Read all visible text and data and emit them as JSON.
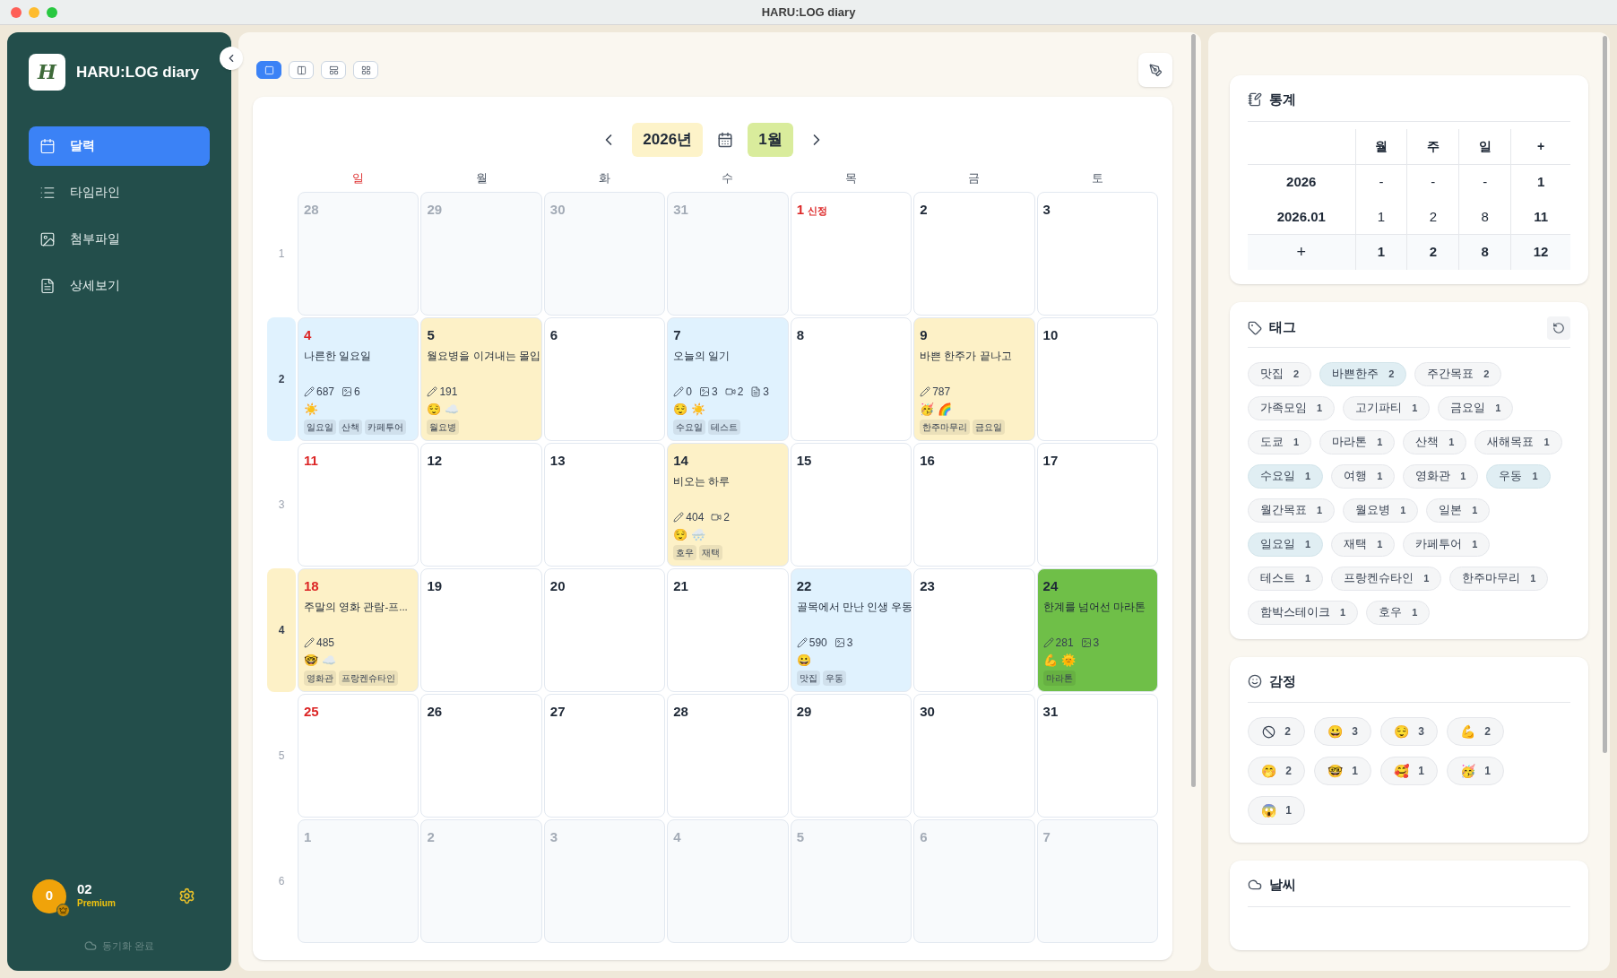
{
  "window": {
    "title": "HARU:LOG diary"
  },
  "sidebar": {
    "logo": "H",
    "app_name": "HARU:LOG diary",
    "items": [
      {
        "label": "달력",
        "selected": true
      },
      {
        "label": "타임라인",
        "selected": false
      },
      {
        "label": "첨부파일",
        "selected": false
      },
      {
        "label": "상세보기",
        "selected": false
      }
    ],
    "user": {
      "avatar": "0",
      "name": "02",
      "plan": "Premium"
    },
    "sync": "동기화 완료"
  },
  "toolbar": {
    "view_buttons": [
      {
        "selected": true
      },
      {
        "selected": false
      },
      {
        "selected": false
      },
      {
        "selected": false
      }
    ]
  },
  "calendar": {
    "year": "2026년",
    "month": "1월",
    "weekdays": [
      "일",
      "월",
      "화",
      "수",
      "목",
      "금",
      "토"
    ],
    "weeks": [
      {
        "number": "1",
        "days": [
          {
            "date": "28",
            "muted": true
          },
          {
            "date": "29",
            "muted": true
          },
          {
            "date": "30",
            "muted": true
          },
          {
            "date": "31",
            "muted": true
          },
          {
            "date": "1",
            "muted": false,
            "holiday": "신정"
          },
          {
            "date": "2",
            "muted": false
          },
          {
            "date": "3",
            "muted": false
          }
        ]
      },
      {
        "number": "2",
        "color": "#e0f2fe",
        "days": [
          {
            "date": "4",
            "muted": false,
            "entry": {
              "color": "#e0f2fe",
              "title": "나른한 일요일",
              "stats": [
                {
                  "kind": "words",
                  "value": "687"
                },
                {
                  "kind": "images",
                  "value": "6"
                }
              ],
              "emojis": [
                "☀️"
              ],
              "tags": [
                "일요일",
                "산책",
                "카페투어"
              ]
            }
          },
          {
            "date": "5",
            "muted": false,
            "entry": {
              "color": "#fdf1c7",
              "title": "월요병을 이겨내는 몰입",
              "stats": [
                {
                  "kind": "words",
                  "value": "191"
                }
              ],
              "emojis": [
                "😌",
                "☁️"
              ],
              "tags": [
                "월요병"
              ]
            }
          },
          {
            "date": "6",
            "muted": false
          },
          {
            "date": "7",
            "muted": false,
            "entry": {
              "color": "#e0f2fe",
              "title": "오늘의 일기",
              "stats": [
                {
                  "kind": "words",
                  "value": "0"
                },
                {
                  "kind": "images",
                  "value": "3"
                },
                {
                  "kind": "videos",
                  "value": "2"
                },
                {
                  "kind": "files",
                  "value": "3"
                }
              ],
              "emojis": [
                "😌",
                "☀️"
              ],
              "tags": [
                "수요일",
                "테스트"
              ]
            }
          },
          {
            "date": "8",
            "muted": false
          },
          {
            "date": "9",
            "muted": false,
            "entry": {
              "color": "#fdf1c7",
              "title": "바쁜 한주가 끝나고",
              "stats": [
                {
                  "kind": "words",
                  "value": "787"
                }
              ],
              "emojis": [
                "🥳",
                "🌈"
              ],
              "tags": [
                "한주마무리",
                "금요일"
              ]
            }
          },
          {
            "date": "10",
            "muted": false
          }
        ]
      },
      {
        "number": "3",
        "days": [
          {
            "date": "11",
            "muted": false
          },
          {
            "date": "12",
            "muted": false
          },
          {
            "date": "13",
            "muted": false
          },
          {
            "date": "14",
            "muted": false,
            "entry": {
              "color": "#fdf1c7",
              "title": "비오는 하루",
              "stats": [
                {
                  "kind": "words",
                  "value": "404"
                },
                {
                  "kind": "videos",
                  "value": "2"
                }
              ],
              "emojis": [
                "😌",
                "🌨️"
              ],
              "tags": [
                "호우",
                "재택"
              ]
            }
          },
          {
            "date": "15",
            "muted": false
          },
          {
            "date": "16",
            "muted": false
          },
          {
            "date": "17",
            "muted": false
          }
        ]
      },
      {
        "number": "4",
        "color": "#fdf1c7",
        "days": [
          {
            "date": "18",
            "muted": false,
            "entry": {
              "color": "#fdf1c7",
              "title": "주말의 영화 관람-프...",
              "stats": [
                {
                  "kind": "words",
                  "value": "485"
                }
              ],
              "emojis": [
                "🤓",
                "☁️"
              ],
              "tags": [
                "영화관",
                "프랑켄슈타인"
              ]
            }
          },
          {
            "date": "19",
            "muted": false
          },
          {
            "date": "20",
            "muted": false
          },
          {
            "date": "21",
            "muted": false
          },
          {
            "date": "22",
            "muted": false,
            "entry": {
              "color": "#e0f2fe",
              "title": "골목에서 만난 인생 우동",
              "stats": [
                {
                  "kind": "words",
                  "value": "590"
                },
                {
                  "kind": "images",
                  "value": "3"
                }
              ],
              "emojis": [
                "😀"
              ],
              "tags": [
                "맛집",
                "우동"
              ]
            }
          },
          {
            "date": "23",
            "muted": false
          },
          {
            "date": "24",
            "muted": false,
            "entry": {
              "color": "#6fbf48",
              "title": "한계를 넘어선 마라톤",
              "stats": [
                {
                  "kind": "words",
                  "value": "281"
                },
                {
                  "kind": "images",
                  "value": "3"
                }
              ],
              "emojis": [
                "💪",
                "🌞"
              ],
              "tags": [
                "마라톤"
              ]
            }
          }
        ]
      },
      {
        "number": "5",
        "days": [
          {
            "date": "25",
            "muted": false
          },
          {
            "date": "26",
            "muted": false
          },
          {
            "date": "27",
            "muted": false
          },
          {
            "date": "28",
            "muted": false
          },
          {
            "date": "29",
            "muted": false
          },
          {
            "date": "30",
            "muted": false
          },
          {
            "date": "31",
            "muted": false
          }
        ]
      },
      {
        "number": "6",
        "days": [
          {
            "date": "1",
            "muted": true
          },
          {
            "date": "2",
            "muted": true
          },
          {
            "date": "3",
            "muted": true
          },
          {
            "date": "4",
            "muted": true
          },
          {
            "date": "5",
            "muted": true
          },
          {
            "date": "6",
            "muted": true
          },
          {
            "date": "7",
            "muted": true
          }
        ]
      }
    ]
  },
  "stats": {
    "title": "통계",
    "columns": [
      "월",
      "주",
      "일",
      "+"
    ],
    "rows": [
      {
        "label": "2026",
        "cells": [
          "-",
          "-",
          "-",
          "1"
        ]
      },
      {
        "label": "2026.01",
        "cells": [
          "1",
          "2",
          "8",
          "11"
        ]
      }
    ],
    "total": {
      "label": "+",
      "cells": [
        "1",
        "2",
        "8",
        "12"
      ]
    }
  },
  "tags": {
    "title": "태그",
    "items": [
      {
        "name": "맛집",
        "count": "2",
        "selected": false
      },
      {
        "name": "바쁜한주",
        "count": "2",
        "selected": true
      },
      {
        "name": "주간목표",
        "count": "2",
        "selected": false
      },
      {
        "name": "가족모임",
        "count": "1",
        "selected": false
      },
      {
        "name": "고기파티",
        "count": "1",
        "selected": false
      },
      {
        "name": "금요일",
        "count": "1",
        "selected": false
      },
      {
        "name": "도쿄",
        "count": "1",
        "selected": false
      },
      {
        "name": "마라톤",
        "count": "1",
        "selected": false
      },
      {
        "name": "산책",
        "count": "1",
        "selected": false
      },
      {
        "name": "새해목표",
        "count": "1",
        "selected": false
      },
      {
        "name": "수요일",
        "count": "1",
        "selected": true
      },
      {
        "name": "여행",
        "count": "1",
        "selected": false
      },
      {
        "name": "영화관",
        "count": "1",
        "selected": false
      },
      {
        "name": "우동",
        "count": "1",
        "selected": true
      },
      {
        "name": "월간목표",
        "count": "1",
        "selected": false
      },
      {
        "name": "월요병",
        "count": "1",
        "selected": false
      },
      {
        "name": "일본",
        "count": "1",
        "selected": false
      },
      {
        "name": "일요일",
        "count": "1",
        "selected": true
      },
      {
        "name": "재택",
        "count": "1",
        "selected": false
      },
      {
        "name": "카페투어",
        "count": "1",
        "selected": false
      },
      {
        "name": "테스트",
        "count": "1",
        "selected": false
      },
      {
        "name": "프랑켄슈타인",
        "count": "1",
        "selected": false
      },
      {
        "name": "한주마무리",
        "count": "1",
        "selected": false
      },
      {
        "name": "함박스테이크",
        "count": "1",
        "selected": false
      },
      {
        "name": "호우",
        "count": "1",
        "selected": false
      }
    ]
  },
  "emotions": {
    "title": "감정",
    "items": [
      {
        "kind": "none",
        "count": "2"
      },
      {
        "kind": "emoji",
        "emoji": "😀",
        "count": "3"
      },
      {
        "kind": "emoji",
        "emoji": "😌",
        "count": "3"
      },
      {
        "kind": "emoji",
        "emoji": "💪",
        "count": "2"
      },
      {
        "kind": "emoji",
        "emoji": "🤭",
        "count": "2"
      },
      {
        "kind": "emoji",
        "emoji": "🤓",
        "count": "1"
      },
      {
        "kind": "emoji",
        "emoji": "🥰",
        "count": "1"
      },
      {
        "kind": "emoji",
        "emoji": "🥳",
        "count": "1"
      },
      {
        "kind": "emoji",
        "emoji": "😱",
        "count": "1"
      }
    ]
  },
  "weather": {
    "title": "날씨"
  }
}
